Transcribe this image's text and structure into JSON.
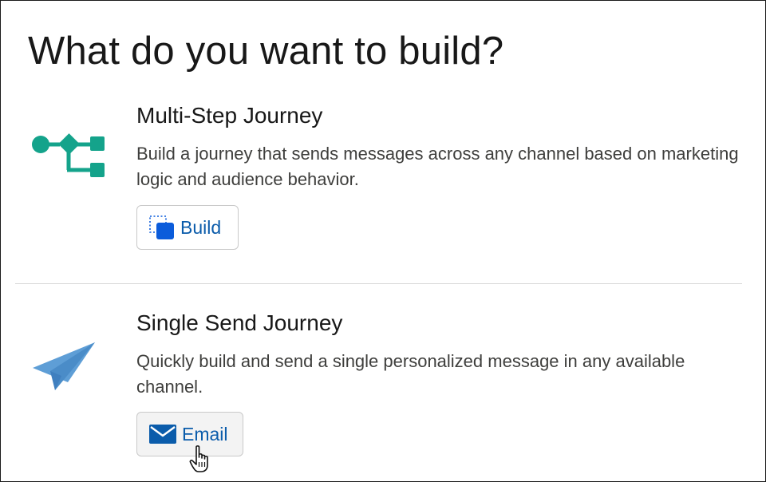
{
  "page": {
    "title": "What do you want to build?"
  },
  "sections": [
    {
      "icon": "multi-step-flow-icon",
      "heading": "Multi-Step Journey",
      "description": "Build a journey that sends messages across any channel based on marketing logic and audience behavior.",
      "button": {
        "label": "Build",
        "icon": "canvas-build-icon"
      }
    },
    {
      "icon": "paper-plane-icon",
      "heading": "Single Send Journey",
      "description": "Quickly build and send a single personalized message in any available channel.",
      "button": {
        "label": "Email",
        "icon": "envelope-icon"
      }
    }
  ],
  "colors": {
    "flow_teal": "#14a38b",
    "plane_blue": "#5e9ed6",
    "link_blue": "#0b5cab",
    "build_icon_blue": "#0b5cdb"
  },
  "cursor": "hand-pointer-cursor"
}
